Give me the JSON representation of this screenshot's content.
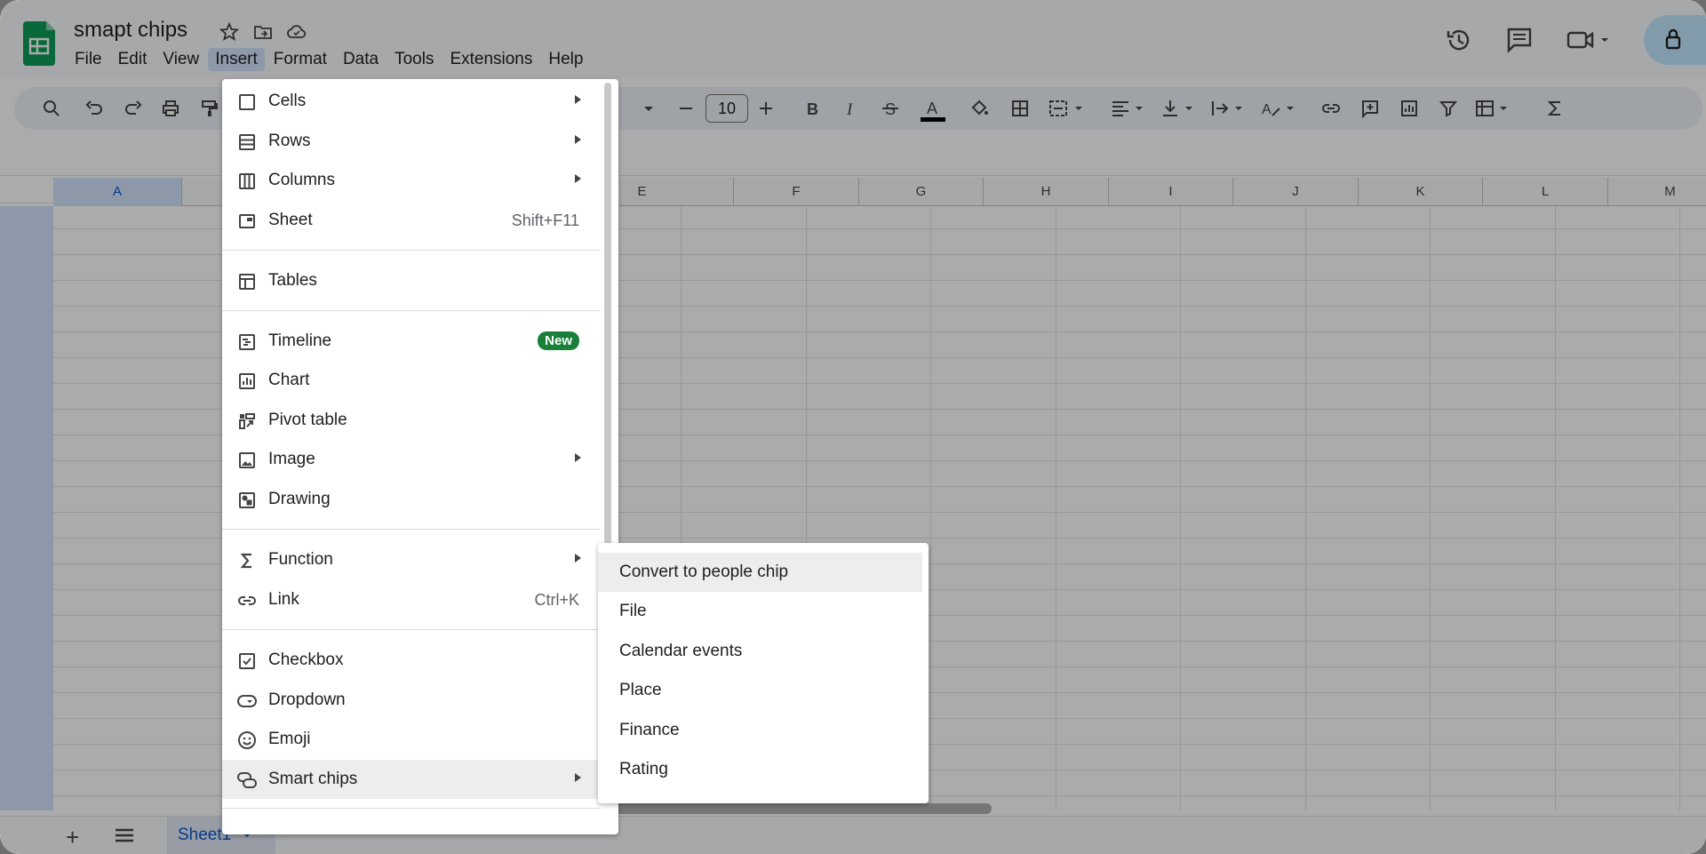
{
  "app": {
    "document_title": "smapt chips",
    "menubar": [
      "File",
      "Edit",
      "View",
      "Insert",
      "Format",
      "Data",
      "Tools",
      "Extensions",
      "Help"
    ],
    "active_menu": "Insert"
  },
  "toolbar": {
    "font_size": "10"
  },
  "grid": {
    "columns": [
      "A",
      "E",
      "F",
      "G",
      "H",
      "I",
      "J",
      "K",
      "L",
      "M"
    ]
  },
  "insert_menu": {
    "items": [
      {
        "label": "Cells",
        "icon": "square-icon",
        "submenu": true
      },
      {
        "label": "Rows",
        "icon": "rows-icon",
        "submenu": true
      },
      {
        "label": "Columns",
        "icon": "columns-icon",
        "submenu": true
      },
      {
        "label": "Sheet",
        "icon": "sheet-icon",
        "shortcut": "Shift+F11"
      },
      {
        "label": "Tables",
        "icon": "table-icon"
      },
      {
        "label": "Timeline",
        "icon": "timeline-icon",
        "badge": "New"
      },
      {
        "label": "Chart",
        "icon": "chart-icon"
      },
      {
        "label": "Pivot table",
        "icon": "pivot-table-icon"
      },
      {
        "label": "Image",
        "icon": "image-icon",
        "submenu": true
      },
      {
        "label": "Drawing",
        "icon": "drawing-icon"
      },
      {
        "label": "Function",
        "icon": "sigma-icon",
        "submenu": true
      },
      {
        "label": "Link",
        "icon": "link-icon",
        "shortcut": "Ctrl+K"
      },
      {
        "label": "Checkbox",
        "icon": "checkbox-icon"
      },
      {
        "label": "Dropdown",
        "icon": "dropdown-icon"
      },
      {
        "label": "Emoji",
        "icon": "emoji-icon"
      },
      {
        "label": "Smart chips",
        "icon": "smart-chips-icon",
        "submenu": true
      }
    ]
  },
  "smart_chips_submenu": {
    "items": [
      "Convert to people chip",
      "File",
      "Calendar events",
      "Place",
      "Finance",
      "Rating"
    ]
  },
  "sheets": {
    "active_tab": "Sheet1"
  },
  "colors": {
    "accent": "#0b57d0",
    "badge_green": "#188038",
    "selection": "#d3e3fd"
  }
}
